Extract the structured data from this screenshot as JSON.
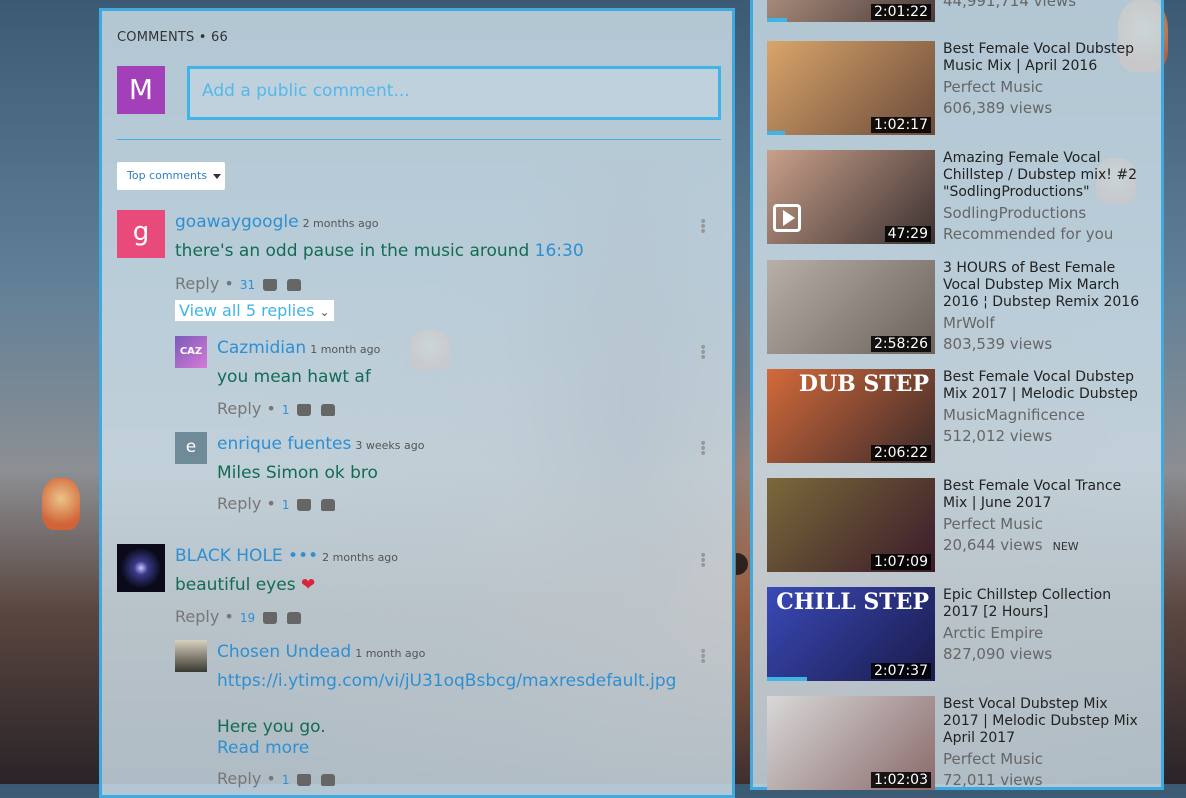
{
  "comments": {
    "header": "COMMENTS • 66",
    "user_avatar_letter": "M",
    "input_placeholder": "Add a public comment...",
    "sort_label": "Top comments",
    "threads": [
      {
        "avatar_letter": "g",
        "avatar_color": "#e84a7a",
        "author": "goawaygoogle",
        "time": "2 months ago",
        "text": "there's an odd pause in the music around ",
        "link": "16:30",
        "reply_label": "Reply",
        "likes": "31",
        "view_replies": "View all 5 replies"
      },
      {
        "author": "Cazmidian",
        "time": "1 month ago",
        "text": "you mean hawt af",
        "reply_label": "Reply",
        "likes": "1",
        "avatar_text": "CAZ"
      },
      {
        "avatar_letter": "e",
        "avatar_color": "#6f8a99",
        "author": "enrique fuentes",
        "time": "3 weeks ago",
        "text": "Miles Simon ok bro",
        "reply_label": "Reply",
        "likes": "1"
      },
      {
        "author": "BLACK HOLE •••",
        "time": "2 months ago",
        "text": "beautiful eyes ",
        "emoji": "❤",
        "reply_label": "Reply",
        "likes": "19"
      },
      {
        "author": "Chosen Undead",
        "time": "1 month ago",
        "text": "https://i.ytimg.com/vi/jU31oqBsbcg/maxresdefault.jpg",
        "text2": "Here you go.",
        "read_more": "Read more",
        "reply_label": "Reply",
        "likes": "1"
      }
    ]
  },
  "sidebar": {
    "top_partial": {
      "duration": "2:01:22",
      "views": "44,991,714 views"
    },
    "videos": [
      {
        "title": "Best Female Vocal Dubstep Music Mix | April 2016",
        "channel": "Perfect Music",
        "views": "606,389 views",
        "duration": "1:02:17",
        "colors": [
          "#d9a56a",
          "#6a4a3a"
        ]
      },
      {
        "title": "Amazing Female Vocal Chillstep / Dubstep mix! #2 \"SodlingProductions\"",
        "channel": "SodlingProductions",
        "views": "Recommended for you",
        "duration": "47:29",
        "colors": [
          "#c9a08a",
          "#3a3030"
        ]
      },
      {
        "title": "3 HOURS of Best Female Vocal Dubstep Mix March 2016 ¦ Dubstep Remix 2016",
        "channel": "MrWolf",
        "views": "803,539 views",
        "duration": "2:58:26",
        "colors": [
          "#b8b0a8",
          "#6a625a"
        ]
      },
      {
        "title": "Best Female Vocal Dubstep Mix 2017 | Melodic Dubstep",
        "channel": "MusicMagnificence",
        "views": "512,012 views",
        "duration": "2:06:22",
        "colors": [
          "#d46a3a",
          "#3a2a2a"
        ],
        "overlay": "DUB STEP"
      },
      {
        "title": "Best Female Vocal Trance Mix | June 2017",
        "channel": "Perfect Music",
        "views": "20,644 views",
        "badge": "NEW",
        "duration": "1:07:09",
        "colors": [
          "#7a6a3a",
          "#3a1a2a"
        ]
      },
      {
        "title": "Epic Chillstep Collection 2017 [2 Hours]",
        "channel": "Arctic Empire",
        "views": "827,090 views",
        "duration": "2:07:37",
        "colors": [
          "#3a4ab8",
          "#1a1a4a"
        ],
        "overlay": "CHILL STEP"
      },
      {
        "title": "Best Vocal Dubstep Mix 2017 | Melodic Dubstep Mix April 2017",
        "channel": "Perfect Music",
        "views": "72,011 views",
        "duration": "1:02:03",
        "colors": [
          "#d8d8d8",
          "#8a6a6a"
        ]
      }
    ]
  }
}
